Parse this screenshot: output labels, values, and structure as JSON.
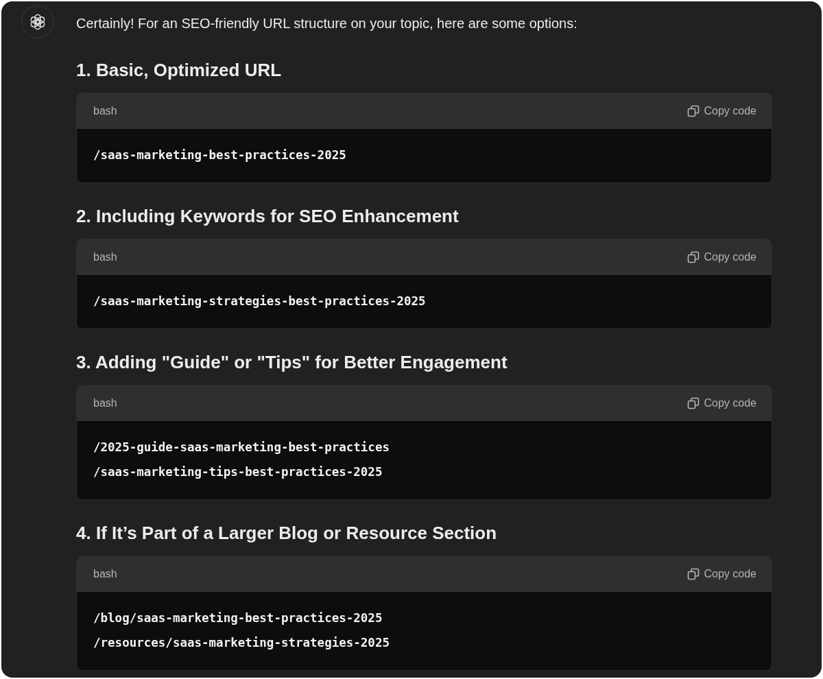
{
  "message": {
    "intro": "Certainly! For an SEO-friendly URL structure on your topic, here are some options:",
    "sections": [
      {
        "heading": "1. Basic, Optimized URL",
        "code": {
          "language": "bash",
          "copy_label": "Copy code",
          "lines": [
            "/saas-marketing-best-practices-2025"
          ]
        }
      },
      {
        "heading": "2. Including Keywords for SEO Enhancement",
        "code": {
          "language": "bash",
          "copy_label": "Copy code",
          "lines": [
            "/saas-marketing-strategies-best-practices-2025"
          ]
        }
      },
      {
        "heading": "3. Adding \"Guide\" or \"Tips\" for Better Engagement",
        "code": {
          "language": "bash",
          "copy_label": "Copy code",
          "lines": [
            "/2025-guide-saas-marketing-best-practices",
            "/saas-marketing-tips-best-practices-2025"
          ]
        }
      },
      {
        "heading": "4. If It’s Part of a Larger Blog or Resource Section",
        "code": {
          "language": "bash",
          "copy_label": "Copy code",
          "lines": [
            "/blog/saas-marketing-best-practices-2025",
            "/resources/saas-marketing-strategies-2025"
          ]
        }
      }
    ]
  }
}
